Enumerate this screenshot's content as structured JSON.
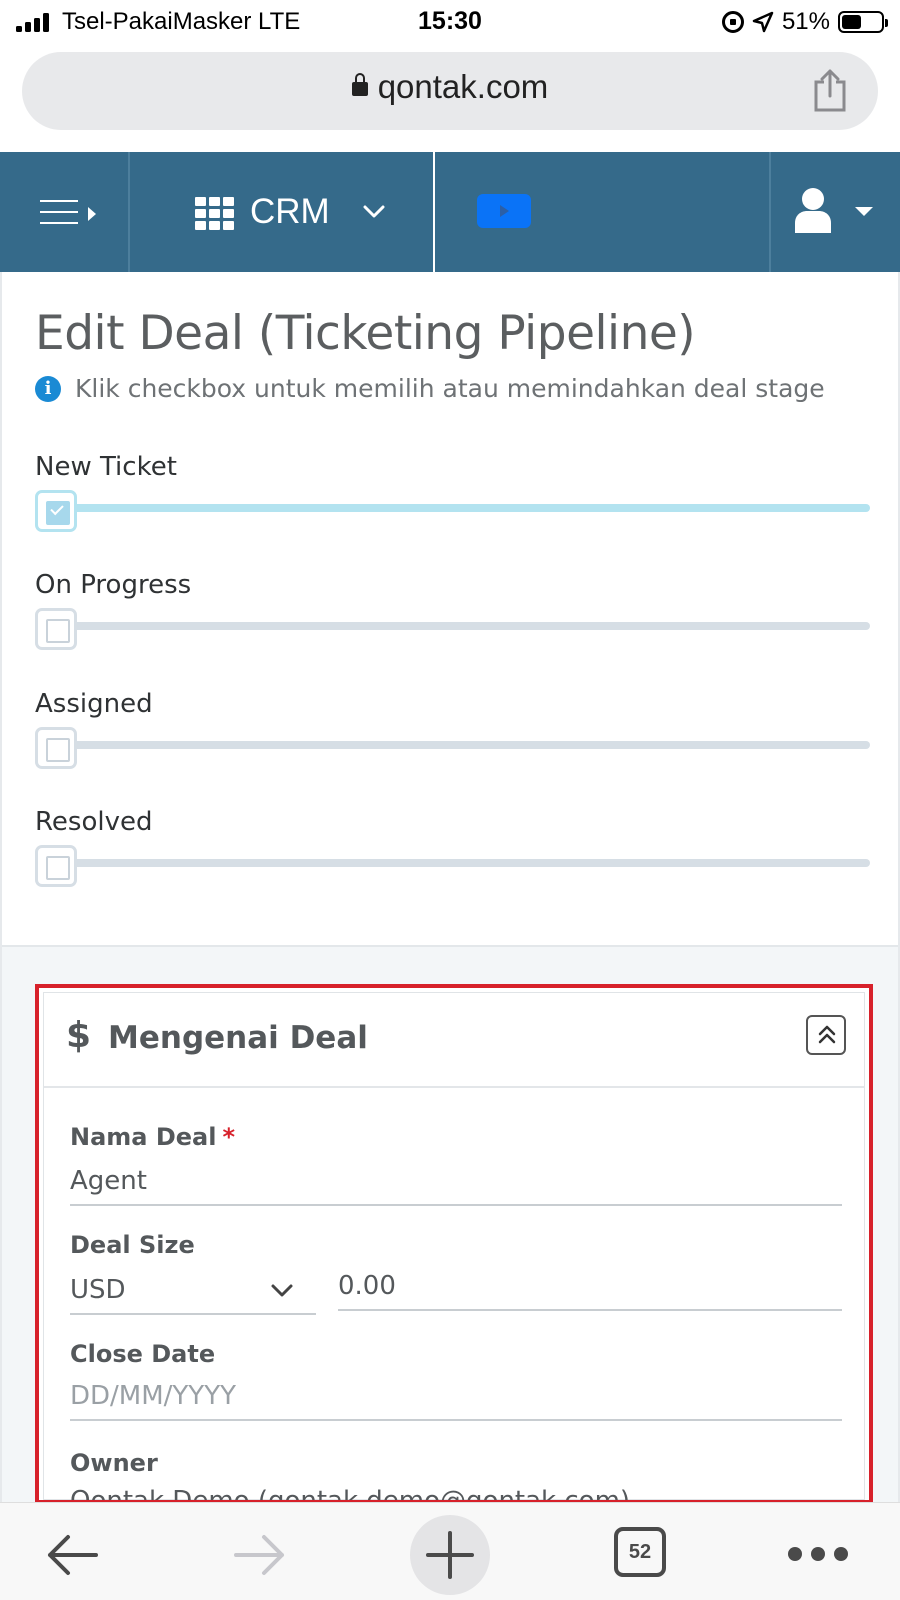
{
  "status_bar": {
    "carrier": "Tsel-PakaiMasker  LTE",
    "time": "15:30",
    "battery": "51%",
    "icons": [
      "signal-icon",
      "rotation-lock-icon",
      "location-arrow-icon",
      "battery-icon"
    ]
  },
  "browser": {
    "url": "qontak.com",
    "icons": [
      "lock-icon",
      "share-icon"
    ]
  },
  "app_nav": {
    "module_label": "CRM",
    "icons": [
      "hamburger-icon",
      "apps-grid-icon",
      "chevron-down-icon",
      "video-play-icon",
      "user-icon",
      "caret-down-icon"
    ]
  },
  "page": {
    "title": "Edit Deal (Ticketing Pipeline)",
    "hint": "Klik checkbox untuk memilih atau memindahkan deal stage"
  },
  "stages": [
    {
      "label": "New Ticket",
      "checked": true
    },
    {
      "label": "On Progress",
      "checked": false
    },
    {
      "label": "Assigned",
      "checked": false
    },
    {
      "label": "Resolved",
      "checked": false
    }
  ],
  "deal_panel": {
    "icon": "$",
    "title": "Mengenai Deal",
    "fields": {
      "nama_deal": {
        "label": "Nama Deal",
        "required_mark": "*",
        "value": "Agent"
      },
      "deal_size": {
        "label": "Deal Size",
        "currency": "USD",
        "amount": "0.00"
      },
      "close_date": {
        "label": "Close Date",
        "placeholder": "DD/MM/YYYY"
      },
      "owner": {
        "label": "Owner",
        "value_partial": "Qontak Demo (qontak.demo@qontak.com)"
      }
    }
  },
  "toolbar": {
    "tab_count": "52",
    "icons": [
      "back-arrow-icon",
      "forward-arrow-icon",
      "new-tab-plus-icon",
      "tabs-icon",
      "more-icon"
    ]
  },
  "colors": {
    "nav_bg": "#356a8a",
    "highlight_border": "#d7212b",
    "info_blue": "#1a8ad4",
    "active_stage": "#b3e3f0",
    "play_button": "#0a73f7"
  }
}
